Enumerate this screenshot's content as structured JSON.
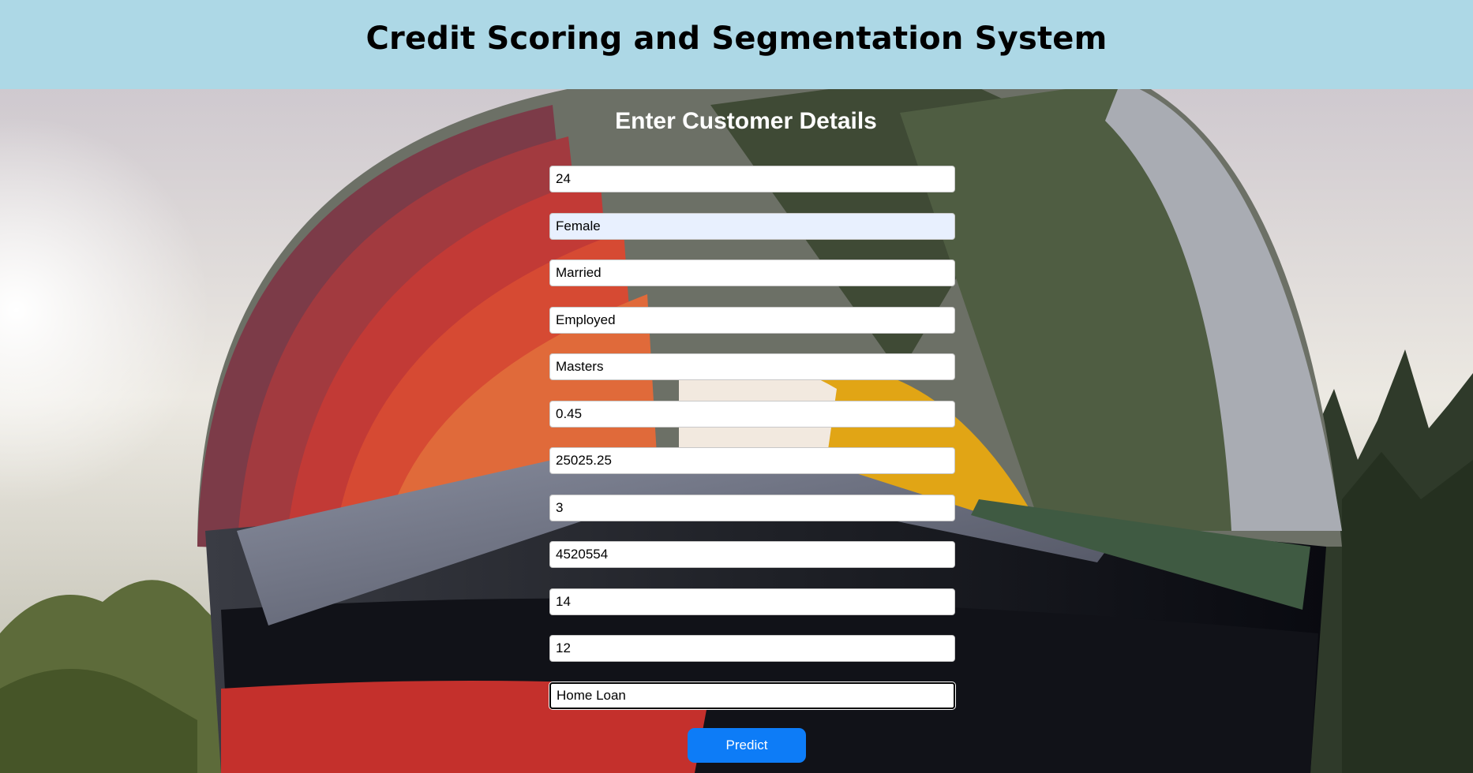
{
  "header": {
    "title": "Credit Scoring and Segmentation System"
  },
  "form": {
    "title": "Enter Customer Details",
    "fields": [
      {
        "name": "age",
        "value": "24"
      },
      {
        "name": "gender",
        "value": "Female"
      },
      {
        "name": "marital-status",
        "value": "Married"
      },
      {
        "name": "employment-status",
        "value": "Employed"
      },
      {
        "name": "education-level",
        "value": "Masters"
      },
      {
        "name": "credit-utilization-ratio",
        "value": "0.45"
      },
      {
        "name": "payment-history",
        "value": "25025.25"
      },
      {
        "name": "number-of-credit-accounts",
        "value": "3"
      },
      {
        "name": "loan-amount",
        "value": "4520554"
      },
      {
        "name": "interest-rate",
        "value": "14"
      },
      {
        "name": "loan-term",
        "value": "12"
      },
      {
        "name": "type-of-loan",
        "value": "Home Loan"
      }
    ],
    "submit_label": "Predict"
  },
  "colors": {
    "header_bg": "#add8e6",
    "button_bg": "#0d7cf7",
    "autofill_bg": "#e8f0fe"
  }
}
